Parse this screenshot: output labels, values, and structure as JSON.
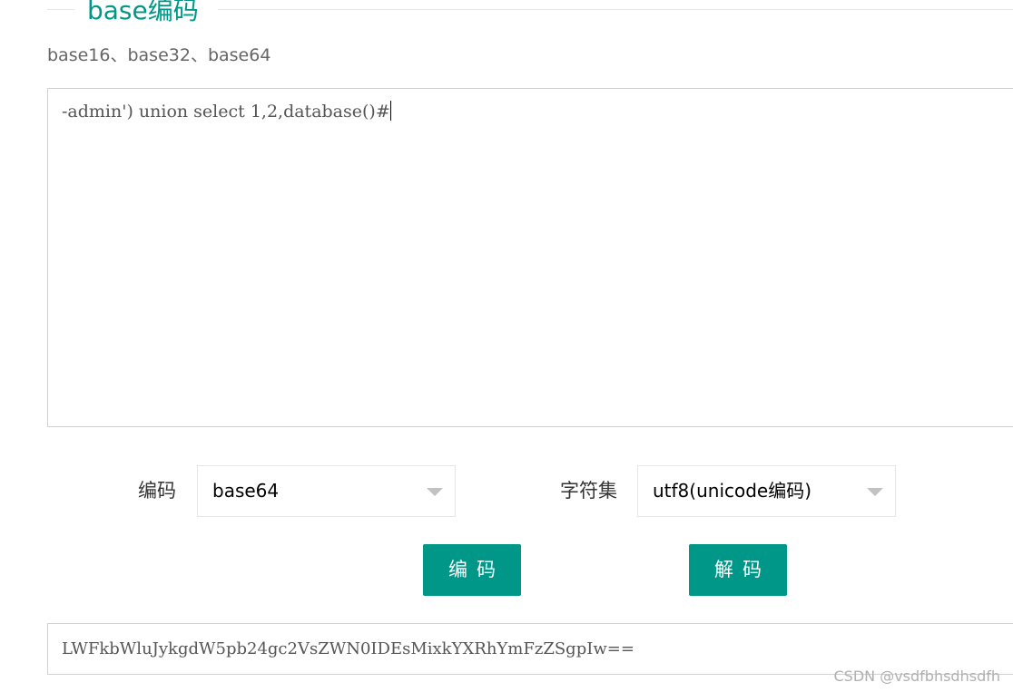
{
  "section": {
    "title": "base编码",
    "subtitle": "base16、base32、base64"
  },
  "input": {
    "value": "-admin') union select 1,2,database()#"
  },
  "options": {
    "encoding_label": "编码",
    "encoding_selected": "base64",
    "charset_label": "字符集",
    "charset_selected": "utf8(unicode编码)"
  },
  "actions": {
    "encode_label": "编码",
    "decode_label": "解码"
  },
  "output": {
    "value": "LWFkbWluJykgdW5pb24gc2VsZWN0IDEsMixkYXRhYmFzZSgpIw=="
  },
  "watermark": "CSDN @vsdfbhsdhsdfh",
  "colors": {
    "accent": "#009688",
    "border": "#d2d2d2",
    "subtitle": "#666666"
  },
  "icons": {
    "select_arrow": "chevron-down-icon"
  }
}
